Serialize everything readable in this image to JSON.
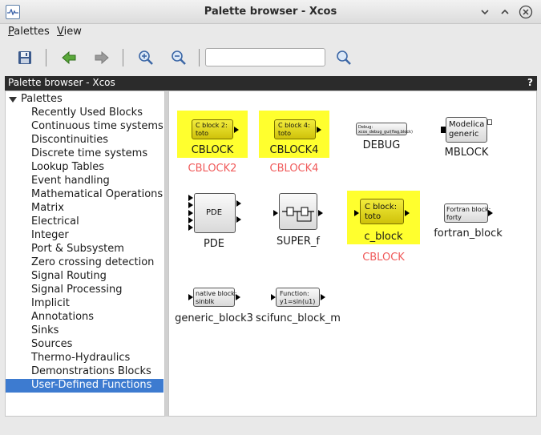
{
  "window": {
    "title": "Palette browser - Xcos"
  },
  "menu": {
    "palettes": "Palettes",
    "palettes_key": "P",
    "palettes_rest": "alettes",
    "view_key": "V",
    "view_rest": "iew"
  },
  "panel": {
    "title": "Palette browser - Xcos",
    "help": "?"
  },
  "search": {
    "value": ""
  },
  "tree": {
    "root": "Palettes",
    "items": [
      "Recently Used Blocks",
      "Continuous time systems",
      "Discontinuities",
      "Discrete time systems",
      "Lookup Tables",
      "Event handling",
      "Mathematical Operations",
      "Matrix",
      "Electrical",
      "Integer",
      "Port & Subsystem",
      "Zero crossing detection",
      "Signal Routing",
      "Signal Processing",
      "Implicit",
      "Annotations",
      "Sinks",
      "Sources",
      "Thermo-Hydraulics",
      "Demonstrations Blocks",
      "User-Defined Functions"
    ],
    "selected": "User-Defined Functions"
  },
  "blocks": {
    "cblock": {
      "line1": "C block 2:",
      "line2": "toto",
      "label": "CBLOCK",
      "red": "CBLOCK2"
    },
    "cblock4": {
      "line1": "C block 4:",
      "line2": "toto",
      "label": "CBLOCK4",
      "red": "CBLOCK4"
    },
    "debug": {
      "line1": "Debug:",
      "line2": "xcos_debug_gui(flag,block)",
      "label": "DEBUG"
    },
    "mblock": {
      "line1": "Modelica",
      "line2": "generic",
      "label": "MBLOCK"
    },
    "pde": {
      "text": "PDE",
      "label": "PDE"
    },
    "super_f": {
      "label": "SUPER_f"
    },
    "c_block": {
      "line1": "C block:",
      "line2": "toto",
      "label": "c_block",
      "red": "CBLOCK"
    },
    "fortran": {
      "line1": "Fortran block:",
      "line2": "forty",
      "label": "fortran_block"
    },
    "generic3": {
      "line1": "native block:",
      "line2": "sinblk",
      "label": "generic_block3"
    },
    "scifunc": {
      "line1": "Function:",
      "line2": "y1=sin(u1)",
      "label": "scifunc_block_m"
    }
  },
  "colors": {
    "highlight": "#ffff2e",
    "red_label": "#f05a5a",
    "selection": "#3d7bd0"
  }
}
